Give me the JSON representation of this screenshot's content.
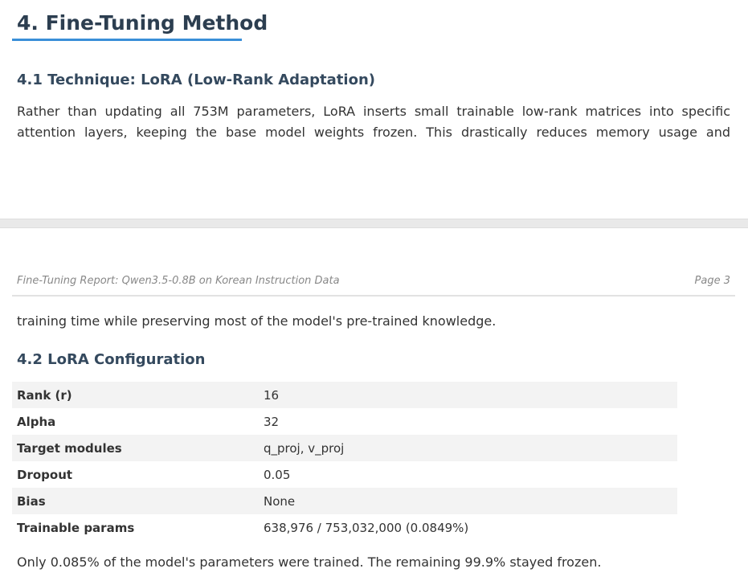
{
  "section": {
    "title": "4. Fine-Tuning Method"
  },
  "subsection_1": {
    "title": "4.1 Technique: LoRA (Low-Rank Adaptation)",
    "paragraph_line_1": "Rather than updating all 753M parameters, LoRA inserts small trainable low-rank matrices into specific",
    "paragraph_line_2": "attention layers, keeping the base model weights frozen. This drastically reduces memory usage and"
  },
  "page_header": {
    "report_title": "Fine-Tuning Report: Qwen3.5-0.8B on Korean Instruction Data",
    "page_label": "Page 3"
  },
  "continuation": {
    "text": "training time while preserving most of the model's pre-trained knowledge."
  },
  "subsection_2": {
    "title": "4.2 LoRA Configuration",
    "rows": [
      {
        "key": "Rank (r)",
        "value": "16"
      },
      {
        "key": "Alpha",
        "value": "32"
      },
      {
        "key": "Target modules",
        "value": "q_proj, v_proj"
      },
      {
        "key": "Dropout",
        "value": "0.05"
      },
      {
        "key": "Bias",
        "value": "None"
      },
      {
        "key": "Trainable params",
        "value": "638,976 / 753,032,000 (0.0849%)"
      }
    ],
    "summary": "Only 0.085% of the model's parameters were trained. The remaining 99.9% stayed frozen."
  }
}
